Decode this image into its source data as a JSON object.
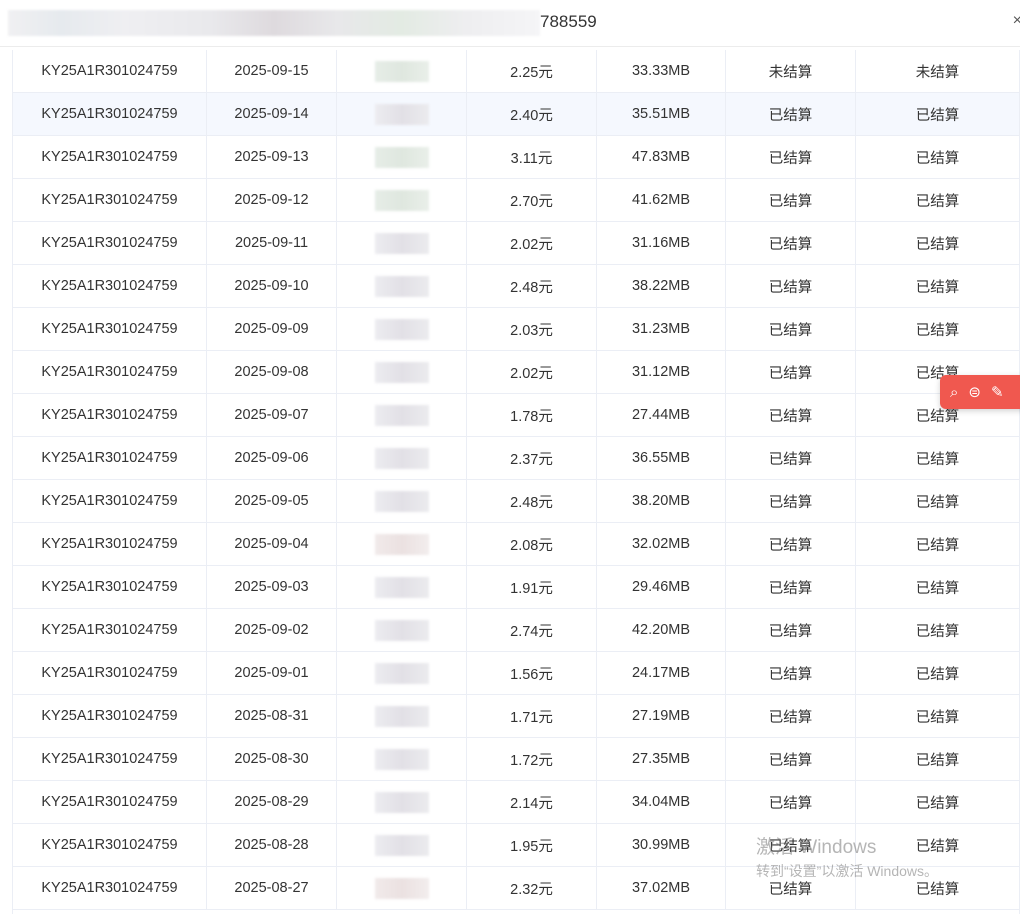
{
  "window": {
    "title_visible": "788559",
    "close_glyph": "×"
  },
  "table": {
    "rows": [
      {
        "id": "KY25A1R301024759",
        "date": "2025-09-15",
        "amount": "2.25元",
        "usage": "33.33MB",
        "status1": "未结算",
        "status2": "未结算",
        "chip": "g"
      },
      {
        "id": "KY25A1R301024759",
        "date": "2025-09-14",
        "amount": "2.40元",
        "usage": "35.51MB",
        "status1": "已结算",
        "status2": "已结算",
        "chip": "n"
      },
      {
        "id": "KY25A1R301024759",
        "date": "2025-09-13",
        "amount": "3.11元",
        "usage": "47.83MB",
        "status1": "已结算",
        "status2": "已结算",
        "chip": "g"
      },
      {
        "id": "KY25A1R301024759",
        "date": "2025-09-12",
        "amount": "2.70元",
        "usage": "41.62MB",
        "status1": "已结算",
        "status2": "已结算",
        "chip": "g"
      },
      {
        "id": "KY25A1R301024759",
        "date": "2025-09-11",
        "amount": "2.02元",
        "usage": "31.16MB",
        "status1": "已结算",
        "status2": "已结算",
        "chip": "n"
      },
      {
        "id": "KY25A1R301024759",
        "date": "2025-09-10",
        "amount": "2.48元",
        "usage": "38.22MB",
        "status1": "已结算",
        "status2": "已结算",
        "chip": "n"
      },
      {
        "id": "KY25A1R301024759",
        "date": "2025-09-09",
        "amount": "2.03元",
        "usage": "31.23MB",
        "status1": "已结算",
        "status2": "已结算",
        "chip": "n"
      },
      {
        "id": "KY25A1R301024759",
        "date": "2025-09-08",
        "amount": "2.02元",
        "usage": "31.12MB",
        "status1": "已结算",
        "status2": "已结算",
        "chip": "n"
      },
      {
        "id": "KY25A1R301024759",
        "date": "2025-09-07",
        "amount": "1.78元",
        "usage": "27.44MB",
        "status1": "已结算",
        "status2": "已结算",
        "chip": "n"
      },
      {
        "id": "KY25A1R301024759",
        "date": "2025-09-06",
        "amount": "2.37元",
        "usage": "36.55MB",
        "status1": "已结算",
        "status2": "已结算",
        "chip": "n"
      },
      {
        "id": "KY25A1R301024759",
        "date": "2025-09-05",
        "amount": "2.48元",
        "usage": "38.20MB",
        "status1": "已结算",
        "status2": "已结算",
        "chip": "n"
      },
      {
        "id": "KY25A1R301024759",
        "date": "2025-09-04",
        "amount": "2.08元",
        "usage": "32.02MB",
        "status1": "已结算",
        "status2": "已结算",
        "chip": "p"
      },
      {
        "id": "KY25A1R301024759",
        "date": "2025-09-03",
        "amount": "1.91元",
        "usage": "29.46MB",
        "status1": "已结算",
        "status2": "已结算",
        "chip": "n"
      },
      {
        "id": "KY25A1R301024759",
        "date": "2025-09-02",
        "amount": "2.74元",
        "usage": "42.20MB",
        "status1": "已结算",
        "status2": "已结算",
        "chip": "n"
      },
      {
        "id": "KY25A1R301024759",
        "date": "2025-09-01",
        "amount": "1.56元",
        "usage": "24.17MB",
        "status1": "已结算",
        "status2": "已结算",
        "chip": "n"
      },
      {
        "id": "KY25A1R301024759",
        "date": "2025-08-31",
        "amount": "1.71元",
        "usage": "27.19MB",
        "status1": "已结算",
        "status2": "已结算",
        "chip": "n"
      },
      {
        "id": "KY25A1R301024759",
        "date": "2025-08-30",
        "amount": "1.72元",
        "usage": "27.35MB",
        "status1": "已结算",
        "status2": "已结算",
        "chip": "n"
      },
      {
        "id": "KY25A1R301024759",
        "date": "2025-08-29",
        "amount": "2.14元",
        "usage": "34.04MB",
        "status1": "已结算",
        "status2": "已结算",
        "chip": "n"
      },
      {
        "id": "KY25A1R301024759",
        "date": "2025-08-28",
        "amount": "1.95元",
        "usage": "30.99MB",
        "status1": "已结算",
        "status2": "已结算",
        "chip": "n"
      },
      {
        "id": "KY25A1R301024759",
        "date": "2025-08-27",
        "amount": "2.32元",
        "usage": "37.02MB",
        "status1": "已结算",
        "status2": "已结算",
        "chip": "p"
      }
    ],
    "highlight_row_index": 1
  },
  "float_toolbar": {
    "color": "#f0584f",
    "icons": [
      "search-icon",
      "chat-icon",
      "magic-wand-icon"
    ],
    "glyphs": [
      "⌕",
      "⊜",
      "✎"
    ]
  },
  "watermark": {
    "line1": "激活 Windows",
    "line2": "转到“设置”以激活 Windows。"
  }
}
